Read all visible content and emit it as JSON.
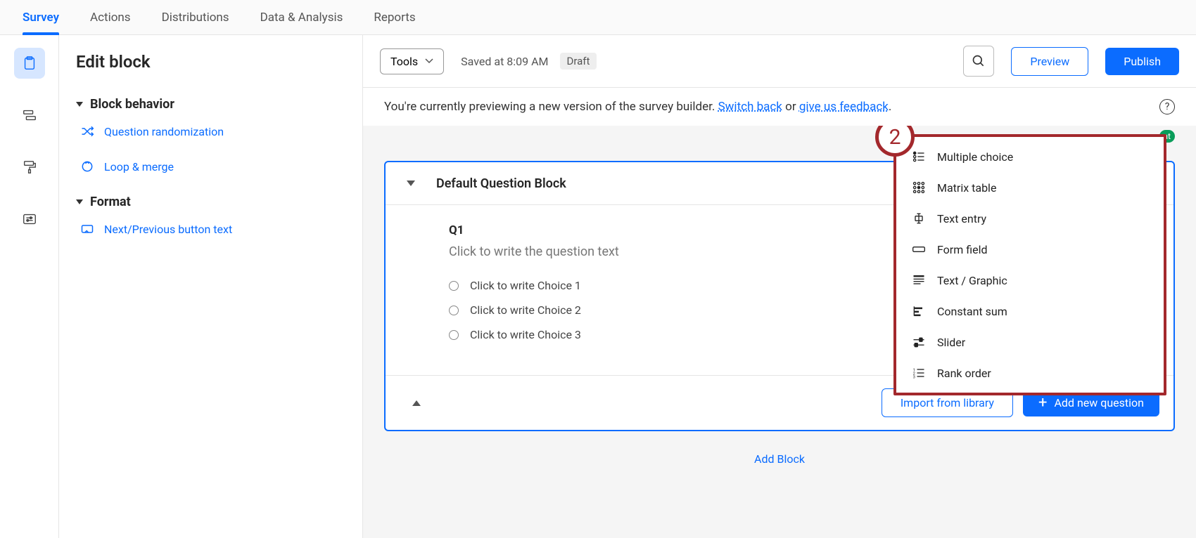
{
  "topTabs": {
    "survey": "Survey",
    "actions": "Actions",
    "distributions": "Distributions",
    "data": "Data & Analysis",
    "reports": "Reports"
  },
  "sidebar": {
    "title": "Edit block",
    "sections": {
      "behavior": "Block behavior",
      "format": "Format"
    },
    "links": {
      "randomization": "Question randomization",
      "loopMerge": "Loop & merge",
      "buttonText": "Next/Previous button text"
    }
  },
  "toolbar": {
    "tools": "Tools",
    "saved": "Saved at 8:09 AM",
    "draft": "Draft",
    "preview": "Preview",
    "publish": "Publish"
  },
  "previewBar": {
    "prefix": "You're currently previewing a new version of the survey builder. ",
    "switchBack": "Switch back",
    "or": " or ",
    "feedback": "give us feedback",
    "period": ".",
    "help": "?"
  },
  "atBadge": "at",
  "block": {
    "title": "Default Question Block",
    "question": {
      "number": "Q1",
      "text": "Click to write the question text",
      "choices": [
        "Click to write Choice 1",
        "Click to write Choice 2",
        "Click to write Choice 3"
      ]
    },
    "importLibrary": "Import from library",
    "addQuestion": "Add new question"
  },
  "addBlock": "Add Block",
  "stepNumber": "2",
  "qTypes": {
    "multipleChoice": "Multiple choice",
    "matrixTable": "Matrix table",
    "textEntry": "Text entry",
    "formField": "Form field",
    "textGraphic": "Text / Graphic",
    "constantSum": "Constant sum",
    "slider": "Slider",
    "rankOrder": "Rank order"
  }
}
